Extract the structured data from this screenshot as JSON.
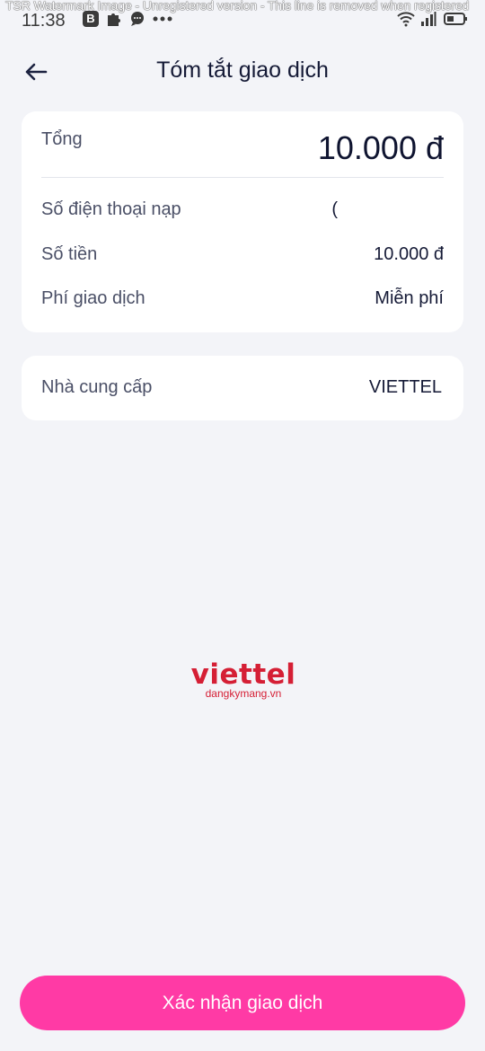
{
  "watermark": "TSR Watermark Image - Unregistered version - This line is removed when registered",
  "status_bar": {
    "time": "11:38",
    "left_icons": [
      "b-app-icon",
      "puzzle-icon",
      "chat-bubble-icon",
      "more-dots-icon"
    ],
    "right_icons": [
      "wifi-icon",
      "signal-icon",
      "battery-icon"
    ],
    "b_label": "B"
  },
  "header": {
    "title": "Tóm tắt giao dịch",
    "back_icon": "arrow-left-icon"
  },
  "summary": {
    "total_label": "Tổng",
    "total_value": "10.000 đ",
    "rows": [
      {
        "label": "Số điện thoại nạp",
        "value": "("
      },
      {
        "label": "Số tiền",
        "value": "10.000 đ"
      },
      {
        "label": "Phí giao dịch",
        "value": "Miễn phí"
      }
    ]
  },
  "provider": {
    "label": "Nhà cung cấp",
    "value": "VIETTEL"
  },
  "logo": {
    "main": "viettel",
    "sub": "dangkymang.vn"
  },
  "confirm_button": "Xác nhận giao dịch",
  "colors": {
    "background": "#f3f4f8",
    "card": "#ffffff",
    "accent_pink": "#ff3aa5",
    "logo_red": "#d51f35",
    "text_dark": "#151a36",
    "text_muted": "#4a4f66"
  }
}
